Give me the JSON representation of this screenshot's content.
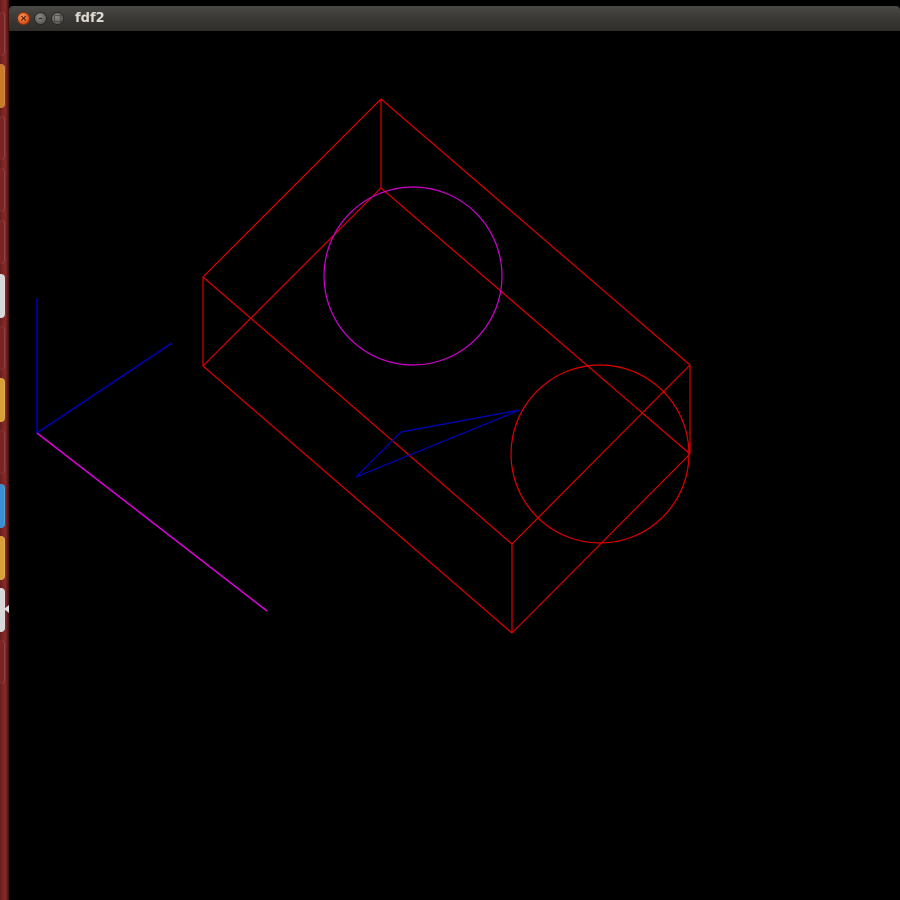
{
  "window": {
    "title": "fdf2",
    "close_glyph": "×",
    "minimize_glyph": "–",
    "maximize_glyph": "□"
  },
  "colors": {
    "background": "#000000",
    "box_edges": "#e00000",
    "circle_top": "#d000d0",
    "circle_side": "#e00000",
    "axis_blue": "#0000c0",
    "axis_magenta": "#e000e0",
    "triangle": "#0000c0"
  },
  "launcher": {
    "icons": [
      "app-icon",
      "app-icon",
      "app-icon",
      "app-icon",
      "app-icon",
      "app-icon",
      "app-icon",
      "app-icon",
      "app-icon",
      "app-icon",
      "app-icon",
      "app-icon"
    ]
  }
}
